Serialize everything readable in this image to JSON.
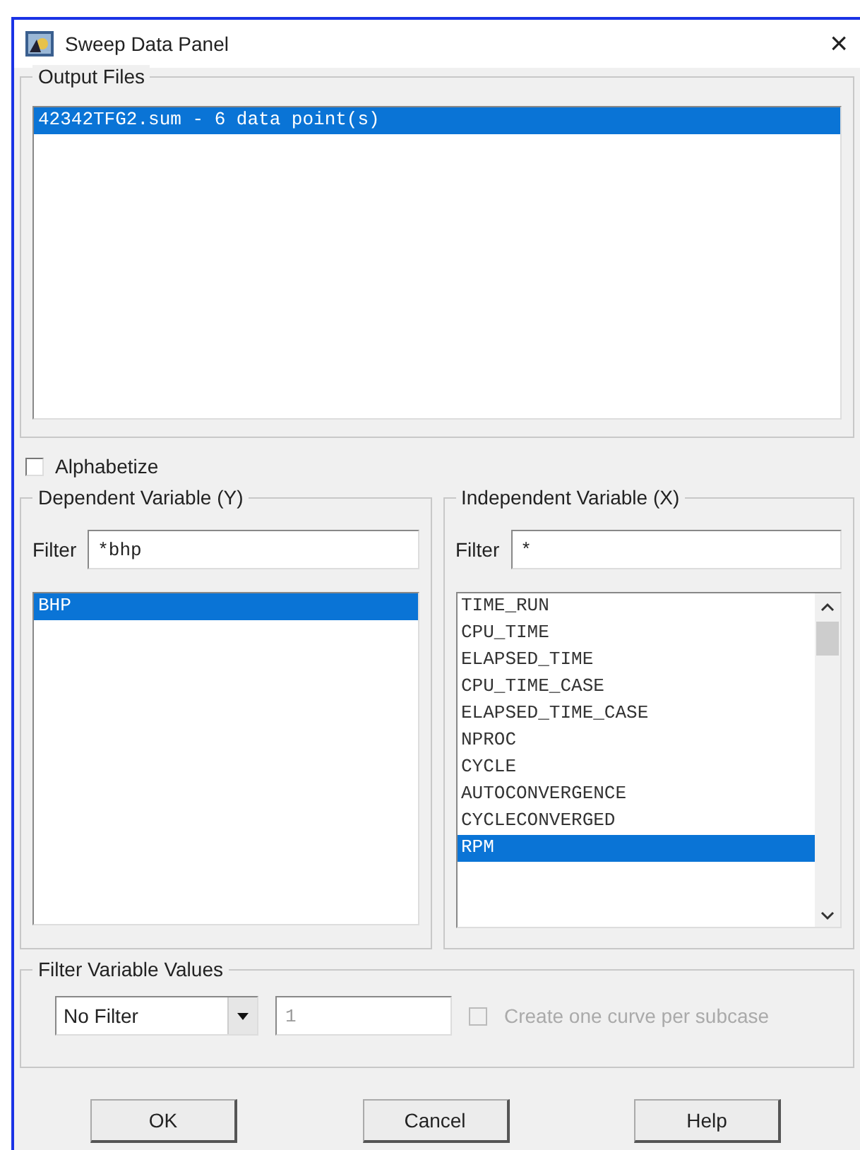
{
  "window": {
    "title": "Sweep Data Panel",
    "close": "×"
  },
  "output_files": {
    "title": "Output Files",
    "items": [
      {
        "label": "42342TFG2.sum - 6 data point(s)",
        "selected": true
      }
    ]
  },
  "alphabetize": {
    "label": "Alphabetize",
    "checked": false
  },
  "dependent": {
    "title": "Dependent Variable (Y)",
    "filter_label": "Filter",
    "filter_value": "*bhp",
    "items": [
      {
        "label": "BHP",
        "selected": true
      }
    ]
  },
  "independent": {
    "title": "Independent Variable (X)",
    "filter_label": "Filter",
    "filter_value": "*",
    "items": [
      {
        "label": "TIME_RUN",
        "selected": false
      },
      {
        "label": "CPU_TIME",
        "selected": false
      },
      {
        "label": "ELAPSED_TIME",
        "selected": false
      },
      {
        "label": "CPU_TIME_CASE",
        "selected": false
      },
      {
        "label": "ELAPSED_TIME_CASE",
        "selected": false
      },
      {
        "label": "NPROC",
        "selected": false
      },
      {
        "label": "CYCLE",
        "selected": false
      },
      {
        "label": "AUTOCONVERGENCE",
        "selected": false
      },
      {
        "label": "CYCLECONVERGED",
        "selected": false
      },
      {
        "label": "RPM",
        "selected": true
      }
    ]
  },
  "filter_values": {
    "title": "Filter Variable Values",
    "dropdown": "No Filter",
    "value": "1",
    "value_disabled": true,
    "subcase": {
      "label": "Create one curve per subcase",
      "checked": false,
      "disabled": true
    }
  },
  "buttons": [
    "OK",
    "Cancel",
    "Help"
  ]
}
